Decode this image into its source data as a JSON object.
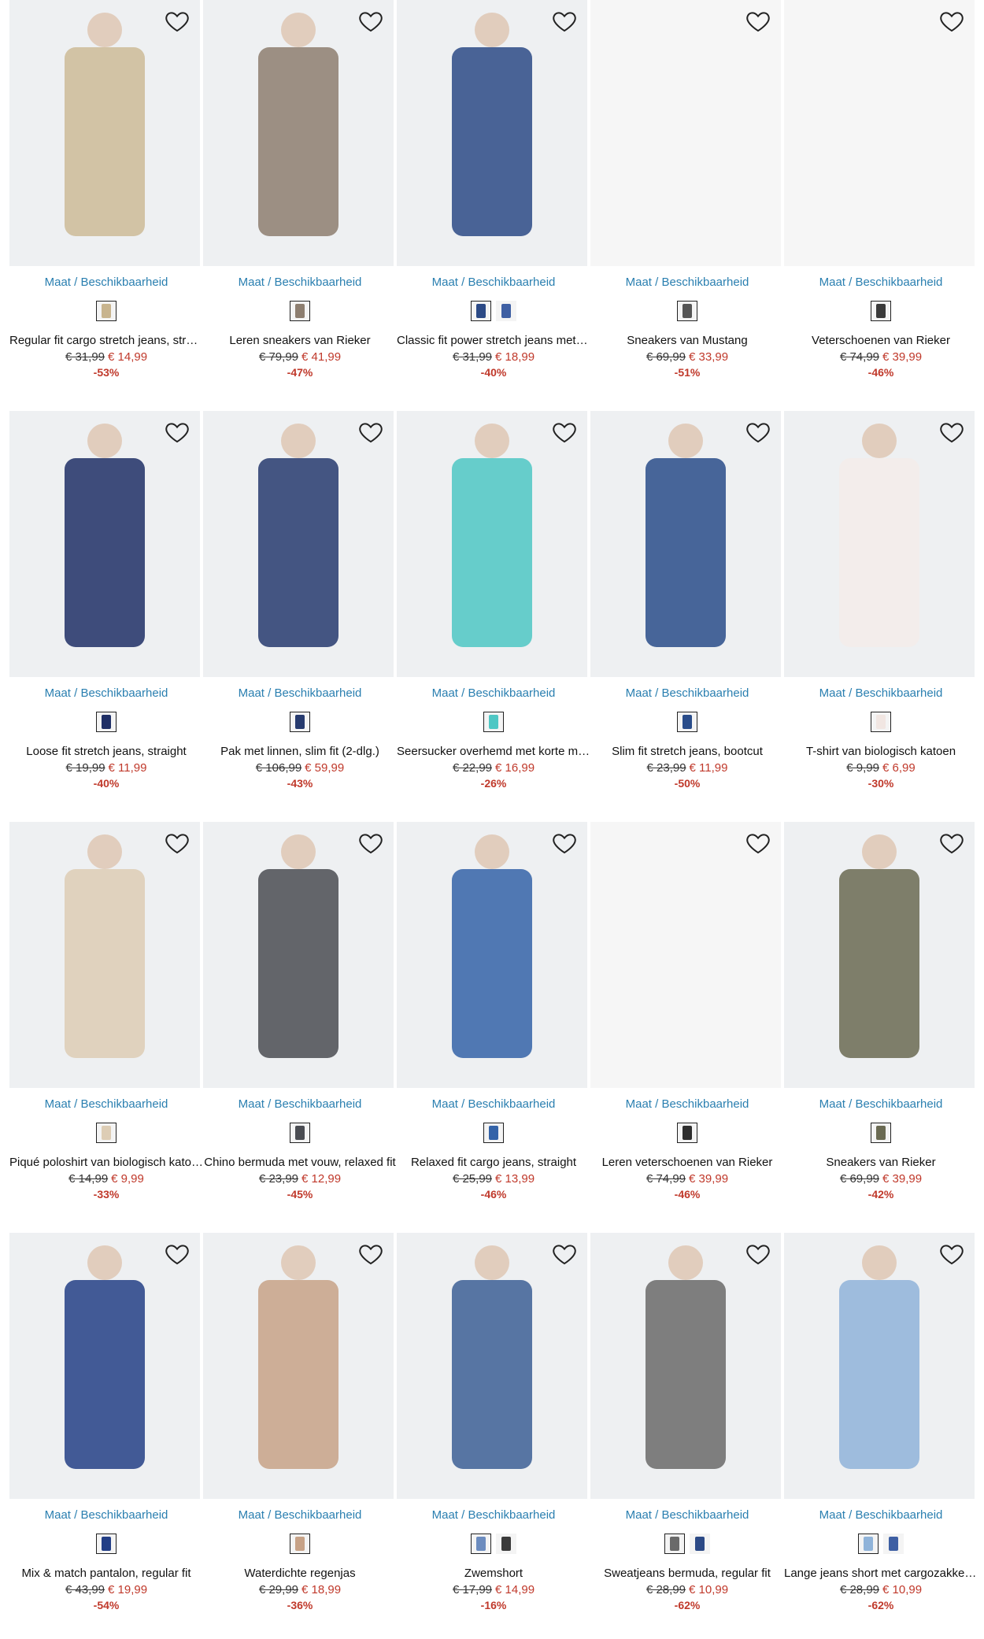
{
  "common": {
    "maat_label": "Maat / Beschikbaarheid"
  },
  "products": [
    {
      "name": "Regular fit cargo stretch jeans, straight",
      "old": "€ 31,99",
      "new": "€ 14,99",
      "disc": "-53%",
      "img": "khaki cargo jeans model",
      "color": "#cdbb98",
      "swatches": [
        "#c8b48e"
      ]
    },
    {
      "name": "Leren sneakers van Rieker",
      "old": "€ 79,99",
      "new": "€ 41,99",
      "disc": "-47%",
      "img": "taupe leather sneaker",
      "color": "#8d7e70",
      "swatches": [
        "#8d7e70"
      ]
    },
    {
      "name": "Classic fit power stretch jeans met comfortband",
      "old": "€ 31,99",
      "new": "€ 18,99",
      "disc": "-40%",
      "img": "dark blue jeans model",
      "color": "#2c4a86",
      "swatches": [
        "#2c4a86",
        "#3e5fa3"
      ]
    },
    {
      "name": "Sneakers van Mustang",
      "old": "€ 69,99",
      "new": "€ 33,99",
      "disc": "-51%",
      "img": "",
      "color": "#f6f6f6",
      "swatches": [
        "#555555"
      ]
    },
    {
      "name": "Veterschoenen van Rieker",
      "old": "€ 74,99",
      "new": "€ 39,99",
      "disc": "-46%",
      "img": "",
      "color": "#f6f6f6",
      "swatches": [
        "#3a3a3a"
      ]
    },
    {
      "name": "Loose fit stretch jeans, straight",
      "old": "€ 19,99",
      "new": "€ 11,99",
      "disc": "-40%",
      "img": "navy loose jeans model",
      "color": "#1f2f66",
      "swatches": [
        "#1f2f66"
      ]
    },
    {
      "name": "Pak met linnen, slim fit (2-dlg.)",
      "old": "€ 106,99",
      "new": "€ 59,99",
      "disc": "-43%",
      "img": "navy linen suit model",
      "color": "#263a6e",
      "swatches": [
        "#263a6e"
      ]
    },
    {
      "name": "Seersucker overhemd met korte mouw",
      "old": "€ 22,99",
      "new": "€ 16,99",
      "disc": "-26%",
      "img": "turquoise check shirt model",
      "color": "#4ec7c4",
      "swatches": [
        "#4ec7c4"
      ]
    },
    {
      "name": "Slim fit stretch jeans, bootcut",
      "old": "€ 23,99",
      "new": "€ 11,99",
      "disc": "-50%",
      "img": "blue bootcut jeans model",
      "color": "#294c8a",
      "swatches": [
        "#294c8a"
      ]
    },
    {
      "name": "T-shirt van biologisch katoen",
      "old": "€ 9,99",
      "new": "€ 6,99",
      "disc": "-30%",
      "img": "white tropical print t-shirt model",
      "color": "#f3ecea",
      "swatches": [
        "#f1e6e2"
      ]
    },
    {
      "name": "Piqué poloshirt van biologisch katoen",
      "old": "€ 14,99",
      "new": "€ 9,99",
      "disc": "-33%",
      "img": "beige polo model back view",
      "color": "#ddcdb5",
      "swatches": [
        "#ddcdb5"
      ]
    },
    {
      "name": "Chino bermuda met vouw, relaxed fit",
      "old": "€ 23,99",
      "new": "€ 12,99",
      "disc": "-45%",
      "img": "grey chino shorts",
      "color": "#4a4c52",
      "swatches": [
        "#4a4c52"
      ]
    },
    {
      "name": "Relaxed fit cargo jeans, straight",
      "old": "€ 25,99",
      "new": "€ 13,99",
      "disc": "-46%",
      "img": "blue cargo jeans model",
      "color": "#3463a8",
      "swatches": [
        "#3463a8"
      ]
    },
    {
      "name": "Leren veterschoenen van Rieker",
      "old": "€ 74,99",
      "new": "€ 39,99",
      "disc": "-46%",
      "img": "",
      "color": "#f6f6f6",
      "swatches": [
        "#2e2e2e"
      ]
    },
    {
      "name": "Sneakers van Rieker",
      "old": "€ 69,99",
      "new": "€ 39,99",
      "disc": "-42%",
      "img": "olive knit sneaker",
      "color": "#6a6a52",
      "swatches": [
        "#6a6a52"
      ]
    },
    {
      "name": "Mix & match pantalon, regular fit",
      "old": "€ 43,99",
      "new": "€ 19,99",
      "disc": "-54%",
      "img": "royal blue trousers model",
      "color": "#233f86",
      "swatches": [
        "#233f86"
      ]
    },
    {
      "name": "Waterdichte regenjas",
      "old": "€ 29,99",
      "new": "€ 18,99",
      "disc": "-36%",
      "img": "beige rain jacket model",
      "color": "#c7a287",
      "swatches": [
        "#c7a287"
      ]
    },
    {
      "name": "Zwemshort",
      "old": "€ 17,99",
      "new": "€ 14,99",
      "disc": "-16%",
      "img": "blue floral swim shorts model",
      "color": "#3c5f95",
      "swatches": [
        "#6c8cbf",
        "#3b3b3b"
      ]
    },
    {
      "name": "Sweatjeans bermuda, regular fit",
      "old": "€ 28,99",
      "new": "€ 10,99",
      "disc": "-62%",
      "img": "grey denim bermuda model",
      "color": "#6a6a6a",
      "swatches": [
        "#6a6a6a",
        "#2c4a86"
      ]
    },
    {
      "name": "Lange jeans short met cargozakken, regular fit",
      "old": "€ 28,99",
      "new": "€ 10,99",
      "disc": "-62%",
      "img": "light blue cargo jeans short model",
      "color": "#8fb3d9",
      "swatches": [
        "#8fb3d9",
        "#3e5fa3"
      ]
    }
  ]
}
